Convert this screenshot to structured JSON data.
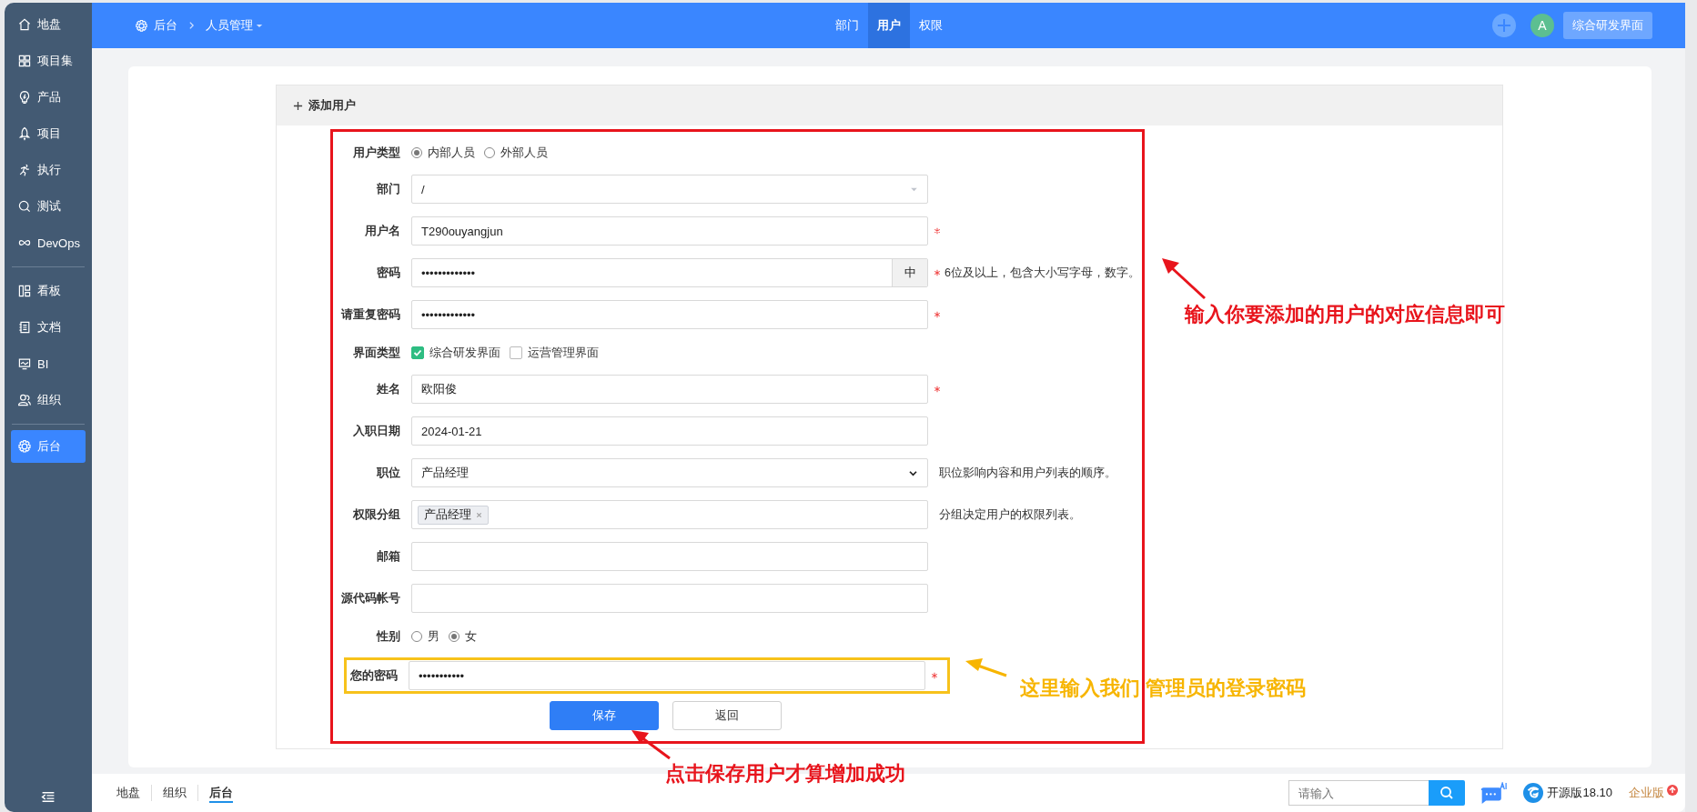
{
  "sidebar": {
    "groups": [
      [
        {
          "label": "地盘",
          "selected": false
        },
        {
          "label": "项目集",
          "selected": false
        },
        {
          "label": "产品",
          "selected": false
        },
        {
          "label": "项目",
          "selected": false
        },
        {
          "label": "执行",
          "selected": false
        },
        {
          "label": "测试",
          "selected": false
        },
        {
          "label": "DevOps",
          "selected": false
        }
      ],
      [
        {
          "label": "看板",
          "selected": false
        },
        {
          "label": "文档",
          "selected": false
        },
        {
          "label": "BI",
          "selected": false
        },
        {
          "label": "组织",
          "selected": false
        }
      ],
      [
        {
          "label": "后台",
          "selected": true
        }
      ]
    ]
  },
  "header": {
    "breadcrumb": [
      "后台",
      "人员管理"
    ],
    "tabs": [
      {
        "label": "部门",
        "selected": false
      },
      {
        "label": "用户",
        "selected": true
      },
      {
        "label": "权限",
        "selected": false
      }
    ],
    "avatar": "A",
    "switch_button": "综合研发界面"
  },
  "panel": {
    "title": "添加用户"
  },
  "form": {
    "highlighted": true,
    "fields": [
      {
        "kind": "radio",
        "label": "用户类型",
        "options": [
          {
            "label": "内部人员",
            "selected": true
          },
          {
            "label": "外部人员",
            "selected": false
          }
        ]
      },
      {
        "kind": "picker",
        "label": "部门",
        "value": "/"
      },
      {
        "kind": "text",
        "label": "用户名",
        "value": "T290ouyangjun",
        "required": true
      },
      {
        "kind": "password",
        "label": "密码",
        "value": "•••••••••••••",
        "required": true,
        "addon": "中",
        "hint": "6位及以上，包含大小写字母，数字。"
      },
      {
        "kind": "password",
        "label": "请重复密码",
        "value": "•••••••••••••",
        "required": true
      },
      {
        "kind": "checkbox",
        "label": "界面类型",
        "options": [
          {
            "label": "综合研发界面",
            "checked": true
          },
          {
            "label": "运营管理界面",
            "checked": false
          }
        ]
      },
      {
        "kind": "text",
        "label": "姓名",
        "value": "欧阳俊",
        "required": true
      },
      {
        "kind": "text",
        "label": "入职日期",
        "value": "2024-01-21"
      },
      {
        "kind": "select",
        "label": "职位",
        "value": "产品经理",
        "hint": "职位影响内容和用户列表的顺序。"
      },
      {
        "kind": "tags",
        "label": "权限分组",
        "tags": [
          "产品经理"
        ],
        "hint": "分组决定用户的权限列表。"
      },
      {
        "kind": "text",
        "label": "邮箱"
      },
      {
        "kind": "text",
        "label": "源代码帐号"
      },
      {
        "kind": "radio",
        "label": "性别",
        "options": [
          {
            "label": "男",
            "selected": false
          },
          {
            "label": "女",
            "selected": true
          }
        ]
      },
      {
        "kind": "password",
        "label": "您的密码",
        "value": "•••••••••••",
        "required": true,
        "highlighted": true
      }
    ],
    "buttons": [
      {
        "label": "保存",
        "kind": "primary"
      },
      {
        "label": "返回",
        "kind": "default"
      }
    ]
  },
  "annotations": [
    {
      "text": "输入你要添加的用户的对应信息即可",
      "color": "#e8141c"
    },
    {
      "text": "这里输入我们 管理员的登录密码",
      "color": "#f7b500"
    },
    {
      "text": "点击保存用户才算增加成功",
      "color": "#e8141c"
    }
  ],
  "bottom_bar": {
    "tabs": [
      {
        "label": "地盘",
        "selected": false
      },
      {
        "label": "组织",
        "selected": false
      },
      {
        "label": "后台",
        "selected": true
      }
    ],
    "search": {
      "placeholder": "请输入"
    },
    "version": "开源版18.10",
    "edition": "企业版"
  }
}
